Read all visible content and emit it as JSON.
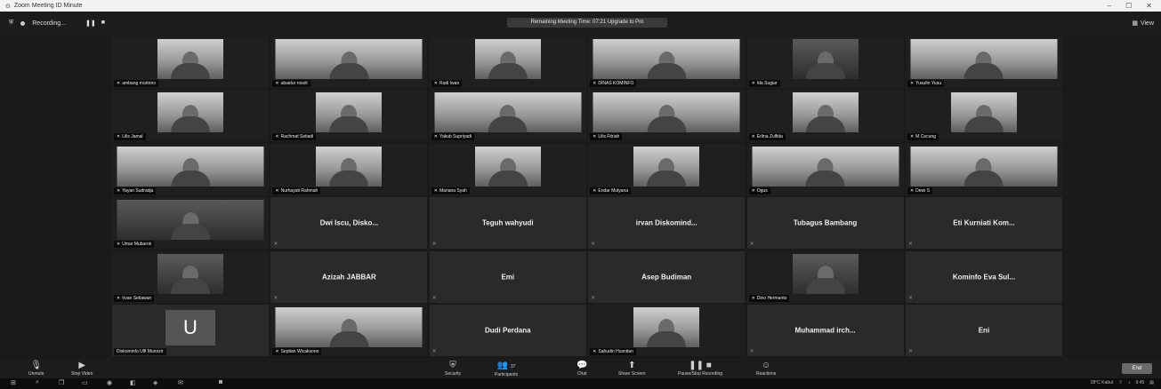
{
  "window": {
    "title": "Zoom Meeting ID Minute",
    "controls": [
      "–",
      "☐",
      "✕"
    ]
  },
  "topbar": {
    "recording_label": "Recording...",
    "banner": "Remaining Meeting Time: 07:21 Upgrade to Pro",
    "view_label": "View"
  },
  "tiles": [
    {
      "type": "video",
      "name": "ambang murtono"
    },
    {
      "type": "video",
      "name": "ubaidur rosoli",
      "wide": true
    },
    {
      "type": "video",
      "name": "Rudi Iwan"
    },
    {
      "type": "video",
      "name": "DINAS KOMINFO",
      "wide": true
    },
    {
      "type": "video",
      "name": "Ida Sugiar",
      "dark": true
    },
    {
      "type": "video",
      "name": "Yusufin Yusu",
      "wide": true
    },
    {
      "type": "video",
      "name": "Lilis Jamal"
    },
    {
      "type": "video",
      "name": "Rachmat Setiadi"
    },
    {
      "type": "video",
      "name": "Yakub Supriyadi",
      "wide": true
    },
    {
      "type": "video",
      "name": "Lilis Fitriah",
      "wide": true
    },
    {
      "type": "video",
      "name": "Erlina Zulfida"
    },
    {
      "type": "video",
      "name": "M Cecung"
    },
    {
      "type": "video",
      "name": "Yayan Sudradja",
      "wide": true
    },
    {
      "type": "video",
      "name": "Nurhayati Rahmah"
    },
    {
      "type": "video",
      "name": "Mariana Syah"
    },
    {
      "type": "video",
      "name": "Endar Mulyana"
    },
    {
      "type": "video",
      "name": "Ogus",
      "wide": true
    },
    {
      "type": "video",
      "name": "Dewi S",
      "wide": true
    },
    {
      "type": "video",
      "name": "Umar Mubarok",
      "dark": true,
      "wide": true
    },
    {
      "type": "name",
      "name": "Dwi Iscu, Disko..."
    },
    {
      "type": "name",
      "name": "Teguh wahyudi"
    },
    {
      "type": "name",
      "name": "irvan Diskomind..."
    },
    {
      "type": "name",
      "name": "Tubagus Bambang"
    },
    {
      "type": "name",
      "name": "Eti Kurniati Kom..."
    },
    {
      "type": "video",
      "name": "Irvan Setiawan",
      "dark": true
    },
    {
      "type": "name",
      "name": "Azizah JABBAR"
    },
    {
      "type": "name",
      "name": "Emi"
    },
    {
      "type": "name",
      "name": "Asep Budiman"
    },
    {
      "type": "video",
      "name": "Dino Hermanto",
      "dark": true
    },
    {
      "type": "name",
      "name": "Kominfo Eva Sul..."
    },
    {
      "type": "avatar",
      "name": "Diskominfo Ulfi Munirzir",
      "initial": "U"
    },
    {
      "type": "video",
      "name": "Septian Wicaksono",
      "wide": true
    },
    {
      "type": "name",
      "name": "Dudi Perdana"
    },
    {
      "type": "video",
      "name": "Sahudin Husnitan"
    },
    {
      "type": "name",
      "name": "Muhammad irch..."
    },
    {
      "type": "name",
      "name": "Eni"
    }
  ],
  "toolbar": {
    "unmute": "Unmute",
    "stop_video": "Stop Video",
    "security": "Security",
    "participants": "Participants",
    "participants_count": "37",
    "chat": "Chat",
    "share_screen": "Share Screen",
    "pause_recording": "Pause/Stop Recording",
    "reactions": "Reactions",
    "end": "End"
  },
  "taskbar": {
    "weather": "28°C Kabut",
    "clock": "9:45"
  }
}
